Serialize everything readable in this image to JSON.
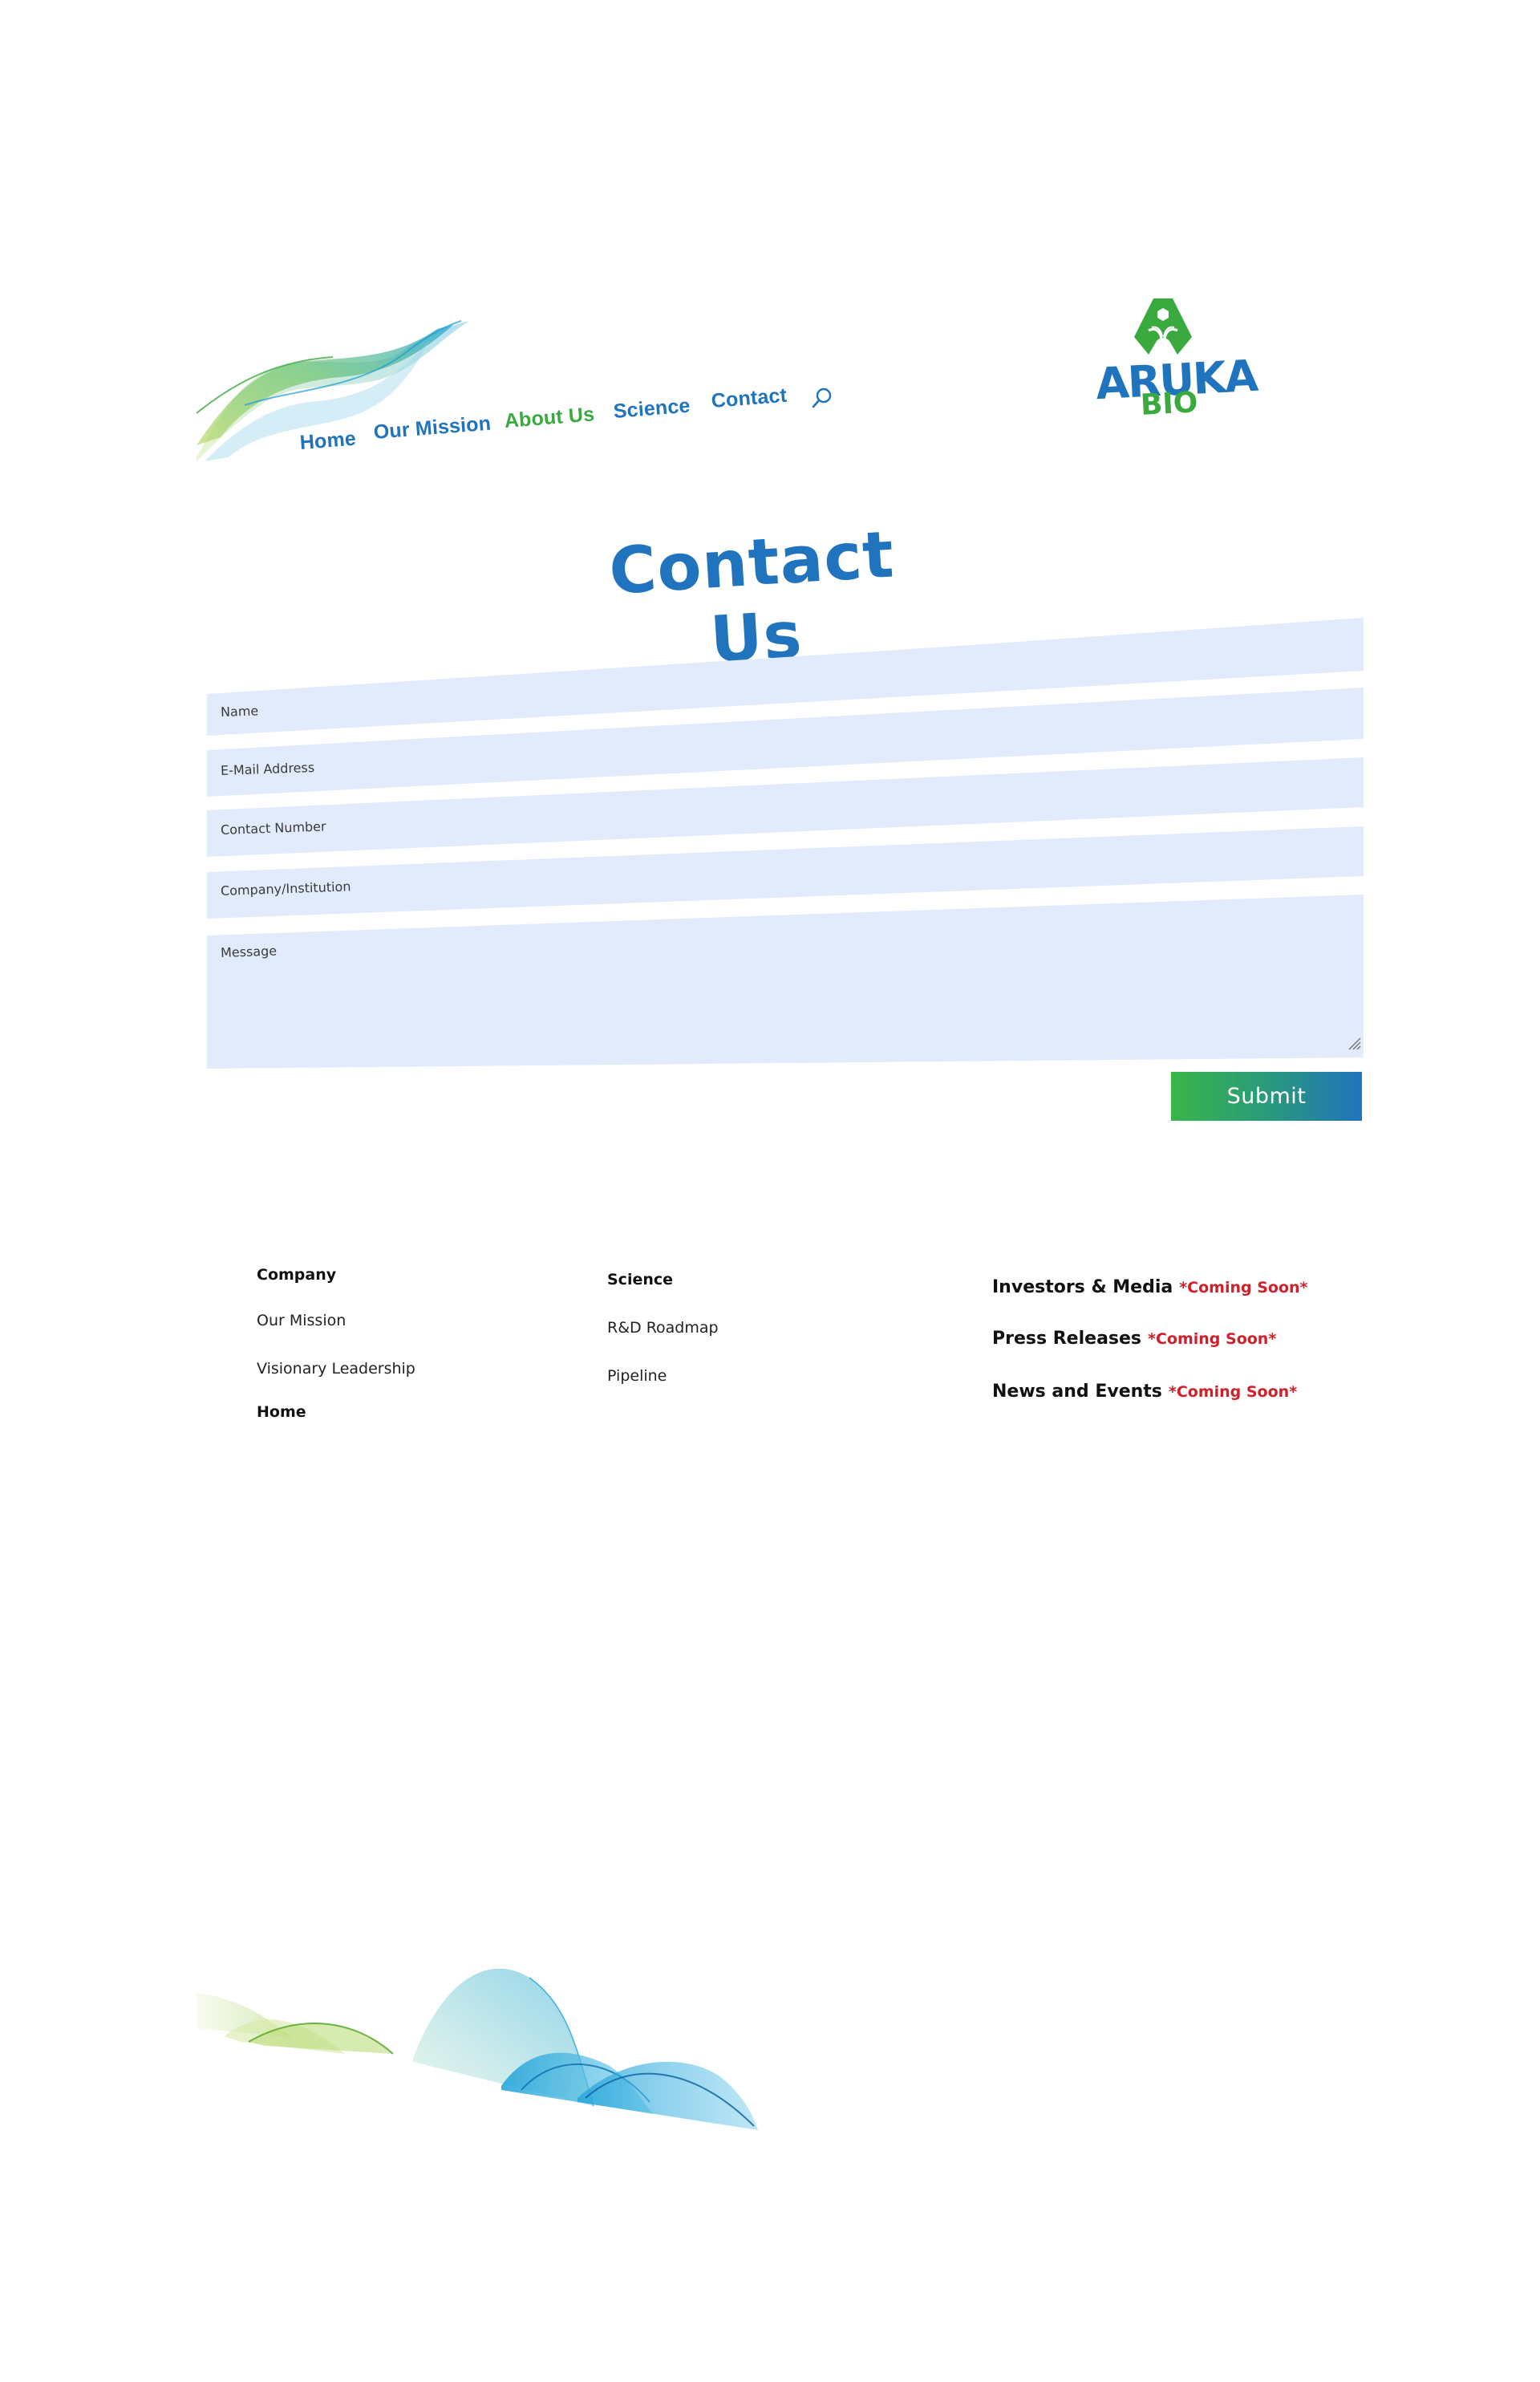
{
  "site": {
    "brand_name": "ARUKA",
    "brand_sub": "BIO",
    "colors": {
      "primary_blue": "#1f74bd",
      "primary_green": "#3aaa3f",
      "field_bg": "#e1ebfb",
      "coming_soon_red": "#d0202a"
    }
  },
  "nav": {
    "items": [
      {
        "label": "Home",
        "active": false
      },
      {
        "label": "Our Mission",
        "active": false
      },
      {
        "label": "About Us",
        "active": true
      },
      {
        "label": "Science",
        "active": false
      },
      {
        "label": "Contact",
        "active": false
      }
    ],
    "search_icon": "search-icon"
  },
  "page": {
    "title": "Contact Us"
  },
  "form": {
    "fields": [
      {
        "placeholder": "Name",
        "value": ""
      },
      {
        "placeholder": "E-Mail Address",
        "value": ""
      },
      {
        "placeholder": "Contact Number",
        "value": ""
      },
      {
        "placeholder": "Company/Institution",
        "value": ""
      }
    ],
    "message": {
      "placeholder": "Message",
      "value": ""
    },
    "submit_label": "Submit"
  },
  "footer": {
    "company": {
      "heading": "Company",
      "links": [
        "Our Mission",
        "Visionary Leadership"
      ],
      "bold_link": "Home"
    },
    "science": {
      "heading": "Science",
      "links": [
        "R&D Roadmap",
        "Pipeline"
      ]
    },
    "investors": [
      {
        "label": "Investors & Media",
        "badge": "*Coming Soon*"
      },
      {
        "label": "Press Releases",
        "badge": "*Coming Soon*"
      },
      {
        "label": "News and Events",
        "badge": "*Coming Soon*"
      }
    ]
  }
}
